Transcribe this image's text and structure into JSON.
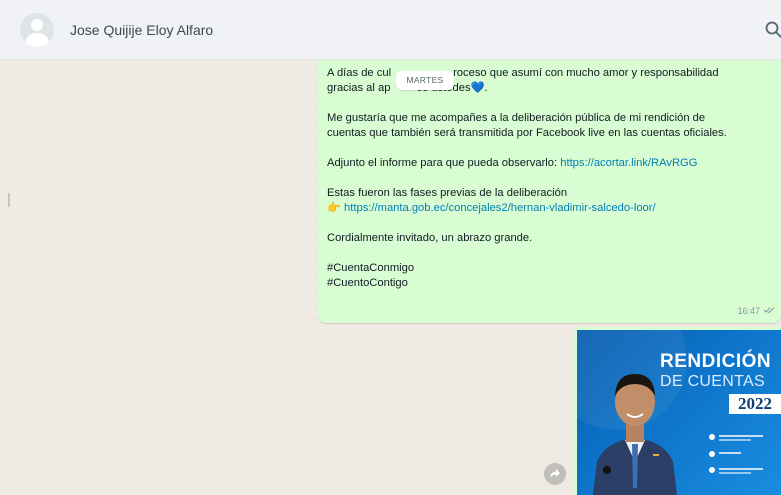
{
  "header": {
    "contact_name": "Jose Quijije Eloy Alfaro",
    "avatar_icon": "default-avatar-icon",
    "search_icon": "search-icon"
  },
  "chat": {
    "day_separator": "MARTES",
    "message": {
      "line1": "A días de cul",
      "line1b": "roceso que asumí con mucho amor y responsabilidad",
      "line2a": "gracias al ap",
      "line2b": "os ustedes",
      "heart": "💙",
      "line2c": ".",
      "para2_l1": "Me gustaría que me acompañes a la deliberación pública de mi rendición de",
      "para2_l2": "cuentas que también será transmitida por Facebook live en las cuentas oficiales.",
      "para3_text": "Adjunto el informe para que pueda observarlo: ",
      "para3_link": "https://acortar.link/RAvRGG",
      "para4_l1": "Estas fueron las fases previas de la deliberación",
      "para4_emoji": "👉",
      "para4_link": "https://manta.gob.ec/concejales2/hernan-vladimir-salcedo-loor/",
      "para5": "Cordialmente invitado, un abrazo grande.",
      "hashtag1": "#CuentaConmigo",
      "hashtag2": "#CuentoContigo",
      "time": "16:47",
      "status_icon": "double-check-icon"
    },
    "image_message": {
      "title_line1": "RENDICIÓN",
      "title_line2": "DE CUENTAS",
      "year": "2022"
    },
    "forward_icon": "forward-icon"
  },
  "colors": {
    "outgoing_bubble": "#d9fdd3",
    "chat_background": "#efeae2",
    "header_background": "#f0f2f5",
    "link": "#027eb5",
    "poster_blue": "#0d74c9"
  }
}
